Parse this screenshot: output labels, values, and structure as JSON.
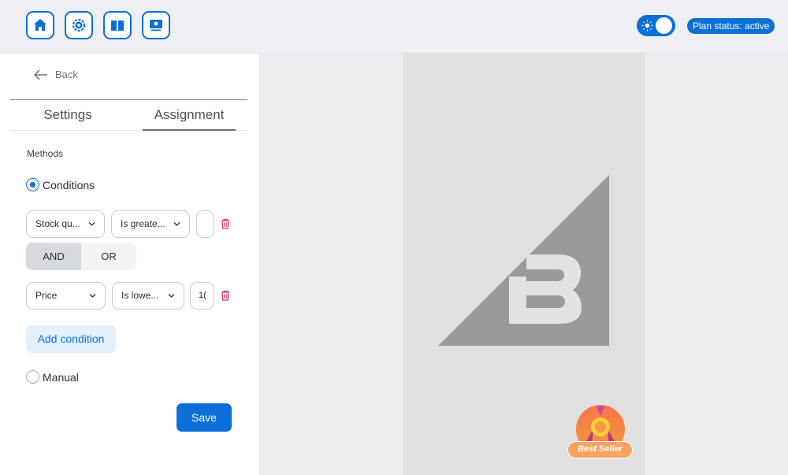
{
  "topbar": {
    "nav_icons": [
      "home-icon",
      "settings-cog-icon",
      "book-icon",
      "screen-icon"
    ],
    "plan_status": "Plan status: active",
    "accent": "#0b6fd8"
  },
  "panel": {
    "back_label": "Back",
    "tabs": [
      {
        "label": "Settings",
        "active": false
      },
      {
        "label": "Assignment",
        "active": true
      }
    ],
    "methods_label": "Methods",
    "conditions_label": "Conditions",
    "conditions": [
      {
        "field": "Stock qu...",
        "operator": "Is greate...",
        "value": ""
      },
      {
        "field": "Price",
        "operator": "Is lowe...",
        "value": "1("
      }
    ],
    "logic": {
      "and_label": "AND",
      "or_label": "OR",
      "selected": "AND"
    },
    "add_condition_label": "Add condition",
    "manual_label": "Manual",
    "save_label": "Save"
  },
  "preview": {
    "badge_text": "Best Seller"
  }
}
